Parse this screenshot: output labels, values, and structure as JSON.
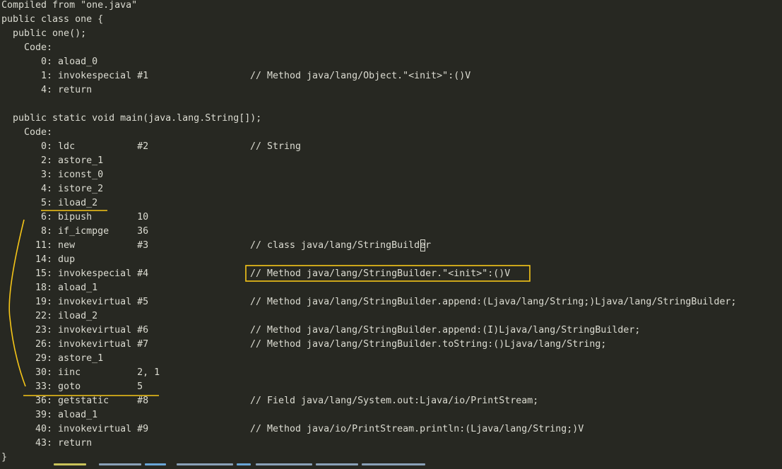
{
  "terminal": {
    "lines": [
      "Compiled from \"one.java\"",
      "public class one {",
      "  public one();",
      "    Code:",
      "       0: aload_0",
      "       1: invokespecial #1",
      "       4: return",
      "",
      "  public static void main(java.lang.String[]);",
      "    Code:",
      "       0: ldc           #2",
      "       2: astore_1",
      "       3: iconst_0",
      "       4: istore_2",
      "       5: iload_2",
      "       6: bipush        10",
      "       8: if_icmpge     36",
      "      11: new           #3",
      "      14: dup",
      "      15: invokespecial #4",
      "      18: aload_1",
      "      19: invokevirtual #5",
      "      22: iload_2",
      "      23: invokevirtual #6",
      "      26: invokevirtual #7",
      "      29: astore_1",
      "      30: iinc          2, 1",
      "      33: goto          5",
      "      36: getstatic     #8",
      "      39: aload_1",
      "      40: invokevirtual #9",
      "      43: return",
      "}"
    ],
    "comments": {
      "5": "// Method java/lang/Object.\"<init>\":()V",
      "10": "// String",
      "17": "// class java/lang/StringBuilder",
      "19": "// Method java/lang/StringBuilder.\"<init>\":()V",
      "21": "// Method java/lang/StringBuilder.append:(Ljava/lang/String;)Ljava/lang/StringBuilder;",
      "23": "// Method java/lang/StringBuilder.append:(I)Ljava/lang/StringBuilder;",
      "24": "// Method java/lang/StringBuilder.toString:()Ljava/lang/String;",
      "28": "// Field java/lang/System.out:Ljava/io/PrintStream;",
      "30": "// Method java/io/PrintStream.println:(Ljava/lang/String;)V"
    }
  },
  "colors": {
    "background": "#272822",
    "text": "#dcdcd2",
    "annotation": "#f5c518"
  }
}
